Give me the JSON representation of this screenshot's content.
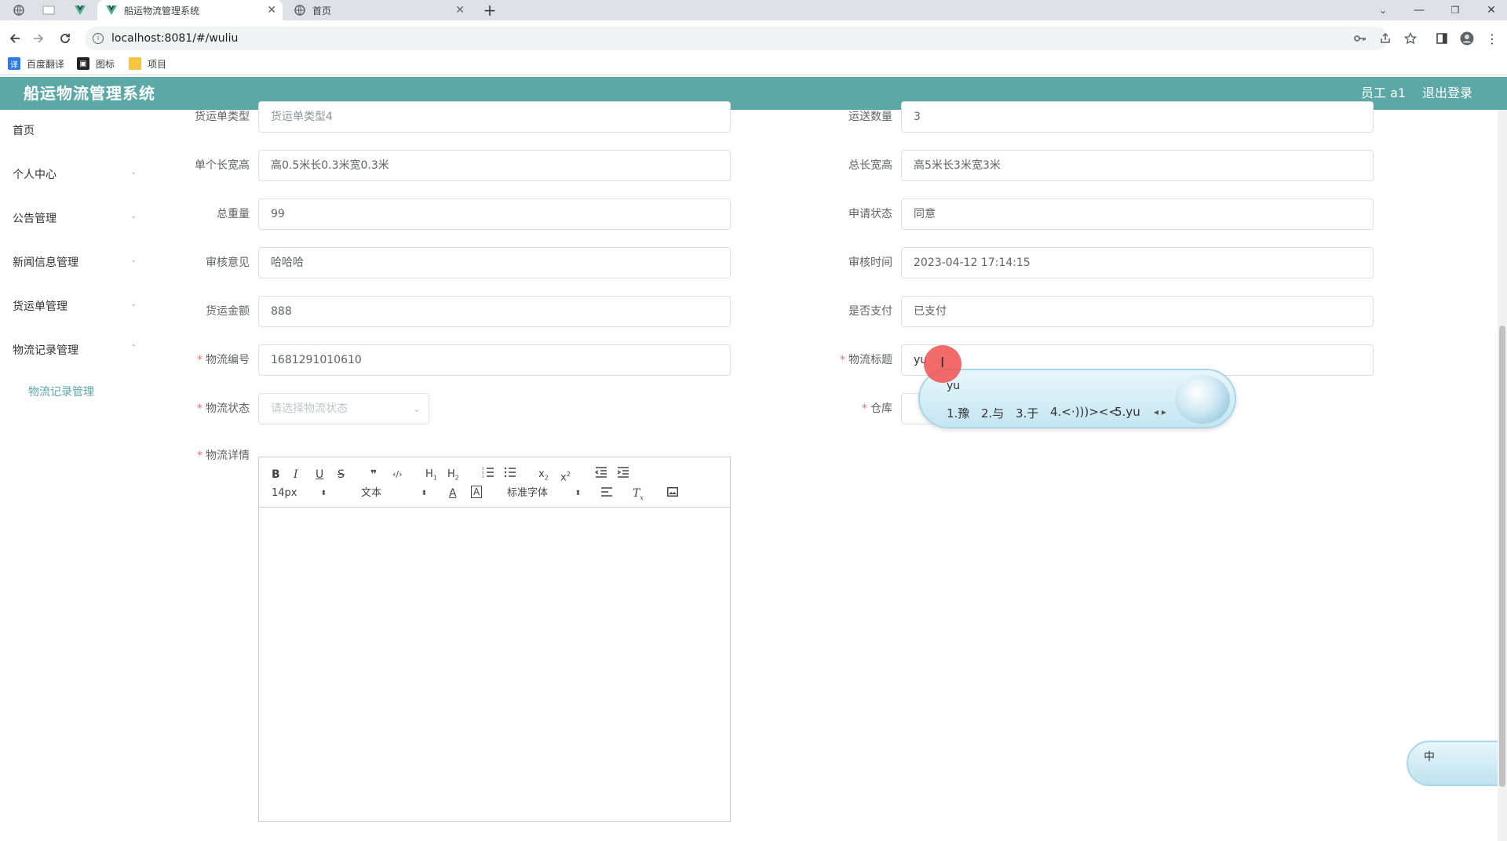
{
  "browser": {
    "tabs": [
      {
        "title": "船运物流管理系统",
        "active": true
      },
      {
        "title": "首页",
        "active": false
      }
    ],
    "url": "localhost:8081/#/wuliu",
    "bookmarks": [
      "百度翻译",
      "图标",
      "项目"
    ]
  },
  "header": {
    "title": "船运物流管理系统",
    "user": "员工 a1",
    "logout": "退出登录"
  },
  "sidebar": {
    "items": [
      "首页",
      "个人中心",
      "公告管理",
      "新闻信息管理",
      "货运单管理",
      "物流记录管理"
    ],
    "sub_item": "物流记录管理"
  },
  "form": {
    "left": [
      {
        "label": "货运单类型",
        "value": "货运单类型4"
      },
      {
        "label": "单个长宽高",
        "value": "高0.5米长0.3米宽0.3米"
      },
      {
        "label": "总重量",
        "value": "99"
      },
      {
        "label": "审核意见",
        "value": "哈哈哈"
      },
      {
        "label": "货运金额",
        "value": "888"
      },
      {
        "label": "物流编号",
        "value": "1681291010610",
        "required": true
      },
      {
        "label": "物流状态",
        "placeholder": "请选择物流状态",
        "required": true
      }
    ],
    "right": [
      {
        "label": "运送数量",
        "value": "3"
      },
      {
        "label": "总长宽高",
        "value": "高5米长3米宽3米"
      },
      {
        "label": "申请状态",
        "value": "同意"
      },
      {
        "label": "审核时间",
        "value": "2023-04-12 17:14:15"
      },
      {
        "label": "是否支付",
        "value": "已支付"
      },
      {
        "label": "物流标题",
        "value": "yu",
        "required": true
      },
      {
        "label": "仓库",
        "required": true
      }
    ],
    "details_label": "物流详情",
    "required_mark": "*"
  },
  "editor": {
    "font_size": "14px",
    "format": "文本",
    "font_family": "标准字体"
  },
  "ime": {
    "input": "yu",
    "candidates": [
      "1.豫",
      "2.与",
      "3.于",
      "4.<·)))><<",
      "5.yu"
    ],
    "status_label": "中"
  }
}
